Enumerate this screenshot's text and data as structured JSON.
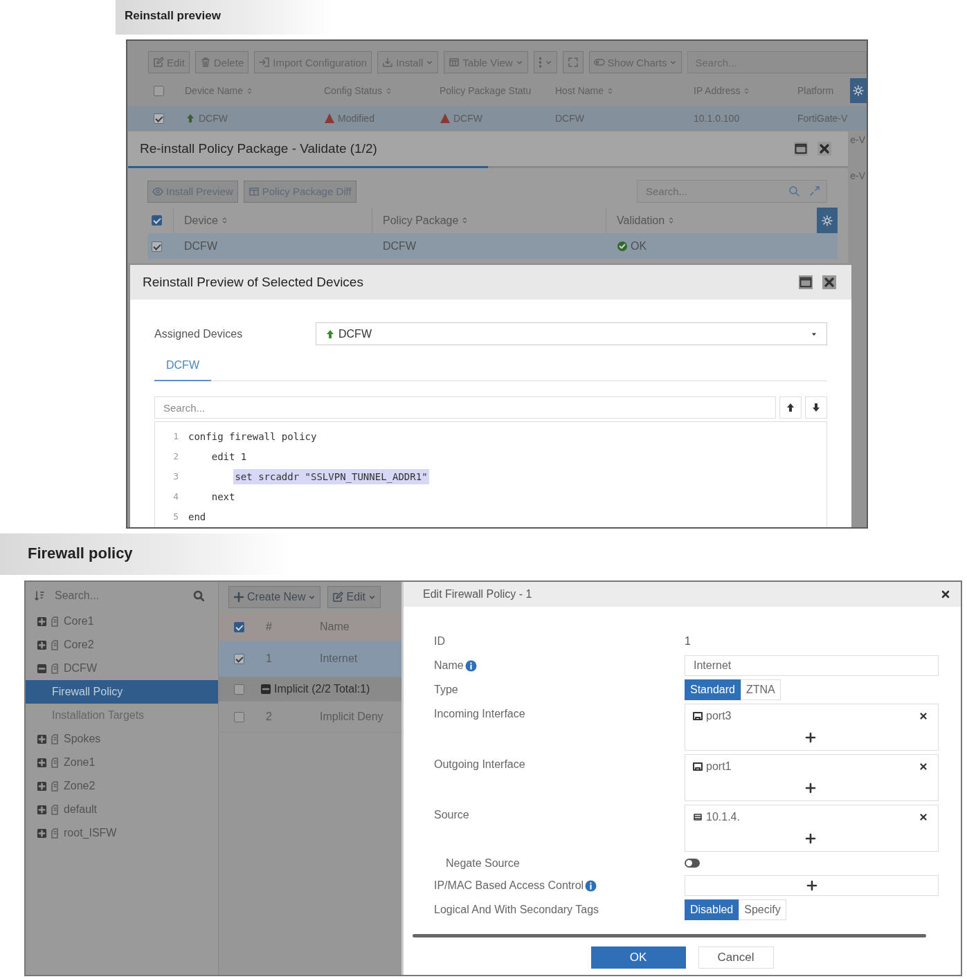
{
  "reinstall_preview": {
    "caption": "Reinstall preview",
    "device_toolbar": [
      {
        "kind": "edit",
        "label": "Edit",
        "dropdown": false
      },
      {
        "kind": "delete",
        "label": "Delete",
        "dropdown": false
      },
      {
        "kind": "import",
        "label": "Import Configuration",
        "dropdown": false
      },
      {
        "kind": "install",
        "label": "Install",
        "dropdown": true
      },
      {
        "kind": "table",
        "label": "Table View",
        "dropdown": true
      },
      {
        "kind": "more",
        "dropdown": true
      },
      {
        "kind": "fullscreen",
        "dropdown": false
      },
      {
        "kind": "charts",
        "label": "Show Charts",
        "dropdown": true
      }
    ],
    "device_search": {
      "placeholder": "Search..."
    },
    "device_table": {
      "header_checked": false,
      "columns": [
        {
          "label": "Device Name",
          "sortable": true
        },
        {
          "label": "Config Status",
          "sortable": true
        },
        {
          "label": "Policy Package Statu",
          "sortable": false
        },
        {
          "label": "Host Name",
          "sortable": true
        },
        {
          "label": "IP Address",
          "sortable": true
        },
        {
          "label": "Platform",
          "sortable": false
        }
      ],
      "rows": [
        {
          "selected": true,
          "checked": true,
          "cells": [
            {
              "kind": "device",
              "text": "DCFW"
            },
            {
              "kind": "warning",
              "text": "Modified"
            },
            {
              "kind": "warning",
              "text": "DCFW"
            },
            {
              "kind": "plain",
              "text": "DCFW"
            },
            {
              "kind": "plain",
              "text": "10.1.0.100"
            },
            {
              "kind": "plain",
              "text": "FortiGate-V"
            }
          ]
        }
      ]
    },
    "behind_fragments": [
      "e-V",
      "e-V"
    ],
    "validate_dialog": {
      "title": "Re-install Policy Package - Validate (1/2)",
      "progress": {
        "level": 0.5
      },
      "toolbar": [
        {
          "kind": "preview",
          "label": "Install Preview"
        },
        {
          "kind": "diff",
          "label": "Policy Package Diff"
        }
      ],
      "search": {
        "placeholder": "Search..."
      },
      "header_checked": true,
      "columns": [
        {
          "label": "Device"
        },
        {
          "label": "Policy Package"
        },
        {
          "label": "Validation"
        }
      ],
      "rows": [
        {
          "selected": true,
          "checked": true,
          "device": "DCFW",
          "policy_package": "DCFW",
          "validation": {
            "kind": "ok",
            "text": "OK"
          }
        }
      ]
    },
    "preview_dialog": {
      "title": "Reinstall Preview of Selected Devices",
      "assigned_devices": {
        "label": "Assigned Devices",
        "value": "DCFW"
      },
      "tabs": [
        {
          "label": "DCFW",
          "selected": true
        }
      ],
      "search": {
        "placeholder": "Search..."
      },
      "code_lines": [
        {
          "number": "1",
          "text": "config firewall policy",
          "highlighted": false
        },
        {
          "number": "2",
          "text": "    edit 1",
          "highlighted": false
        },
        {
          "number": "3",
          "text": "        set srcaddr \"SSLVPN_TUNNEL_ADDR1\"",
          "highlighted": true
        },
        {
          "number": "4",
          "text": "    next",
          "highlighted": false
        },
        {
          "number": "5",
          "text": "end",
          "highlighted": false
        }
      ]
    }
  },
  "firewall_policy": {
    "caption": "Firewall policy",
    "tree_search": {
      "placeholder": "Search..."
    },
    "tree": [
      {
        "label": "Core1",
        "expanded": false,
        "selected": false
      },
      {
        "label": "Core2",
        "expanded": false,
        "selected": false
      },
      {
        "label": "DCFW",
        "expanded": true,
        "selected": false,
        "children": [
          {
            "label": "Firewall Policy",
            "selected": true
          },
          {
            "label": "Installation Targets",
            "selected": false
          }
        ]
      },
      {
        "label": "Spokes",
        "expanded": false,
        "selected": false
      },
      {
        "label": "Zone1",
        "expanded": false,
        "selected": false
      },
      {
        "label": "Zone2",
        "expanded": false,
        "selected": false
      },
      {
        "label": "default",
        "expanded": false,
        "selected": false
      },
      {
        "label": "root_ISFW",
        "expanded": false,
        "selected": false
      }
    ],
    "toolbar": [
      {
        "kind": "create",
        "label": "Create New"
      },
      {
        "kind": "edit",
        "label": "Edit"
      }
    ],
    "policy_table": {
      "header_checked": true,
      "columns": [
        {
          "label": "#"
        },
        {
          "label": "Name"
        }
      ],
      "rows": [
        {
          "kind": "policy",
          "selected": true,
          "checked": true,
          "id": "1",
          "name": "Internet"
        },
        {
          "kind": "group",
          "selected": false,
          "checked": false,
          "expanded": true,
          "name": "Implicit (2/2 Total:1)"
        },
        {
          "kind": "policy",
          "selected": false,
          "checked": false,
          "id": "2",
          "name": "Implicit Deny"
        }
      ]
    },
    "edit_dialog": {
      "title": "Edit Firewall Policy - 1",
      "fields": [
        {
          "kind": "text",
          "label": "ID",
          "value": "1"
        },
        {
          "kind": "input",
          "label": "Name",
          "info": true,
          "value": "Internet"
        },
        {
          "kind": "choice",
          "label": "Type",
          "options": [
            {
              "label": "Standard",
              "selected": true
            },
            {
              "label": "ZTNA",
              "selected": false
            }
          ]
        },
        {
          "kind": "list",
          "label": "Incoming Interface",
          "entries": [
            {
              "kind": "interface",
              "text": "port3"
            }
          ]
        },
        {
          "kind": "list",
          "label": "Outgoing Interface",
          "entries": [
            {
              "kind": "interface",
              "text": "port1"
            }
          ]
        },
        {
          "kind": "list",
          "label": "Source",
          "entries": [
            {
              "kind": "address",
              "text": "10.1.4."
            }
          ]
        },
        {
          "kind": "switch",
          "label": "Negate Source",
          "on": false
        },
        {
          "kind": "add",
          "label": "IP/MAC Based Access Control",
          "info": true
        },
        {
          "kind": "choice",
          "label": "Logical And With Secondary Tags",
          "options": [
            {
              "label": "Disabled",
              "selected": true
            },
            {
              "label": "Specify",
              "selected": false
            }
          ]
        }
      ],
      "buttons": [
        {
          "kind": "primary",
          "label": "OK"
        },
        {
          "kind": "secondary",
          "label": "Cancel"
        }
      ]
    }
  }
}
